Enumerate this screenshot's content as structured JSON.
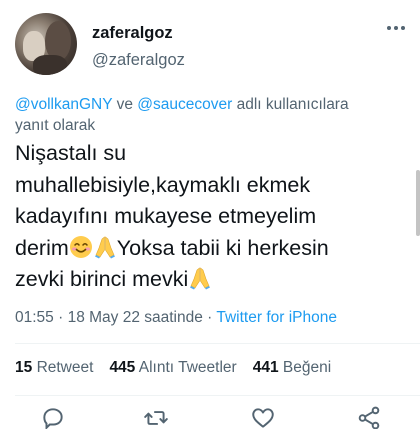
{
  "author": {
    "display_name": "zaferalgoz",
    "handle": "@zaferalgoz"
  },
  "reply": {
    "mention1": "@vollkanGNY",
    "connector": " ve ",
    "mention2": "@saucecover",
    "suffix": " adlı kullanıcılara",
    "line2": "yanıt olarak"
  },
  "tweet": {
    "line1": "Nişastalı su",
    "line2": "muhallebisiyle,kaymaklı ekmek",
    "line3": "kadayıfını mukayese etmeyelim",
    "line4_start": "derim",
    "line4_end": "Yoksa tabii ki herkesin",
    "line5": "zevki birinci mevki"
  },
  "meta": {
    "time": "01:55",
    "sep1": " · ",
    "date": "18 May 22 saatinde",
    "sep2": " · ",
    "source": "Twitter for iPhone"
  },
  "stats": {
    "retweets_count": "15",
    "retweets_label": "Retweet",
    "quotes_count": "445",
    "quotes_label": "Alıntı Tweetler",
    "likes_count": "441",
    "likes_label": "Beğeni"
  },
  "icons": {
    "smile": "smiling-face-with-smiling-eyes",
    "pray": "folded-hands",
    "reply": "reply-icon",
    "retweet": "retweet-icon",
    "like": "heart-icon",
    "share": "share-icon"
  },
  "colors": {
    "link": "#1d9bf0",
    "secondary": "#536471",
    "primary": "#0f1419",
    "divider": "#eff3f4"
  }
}
